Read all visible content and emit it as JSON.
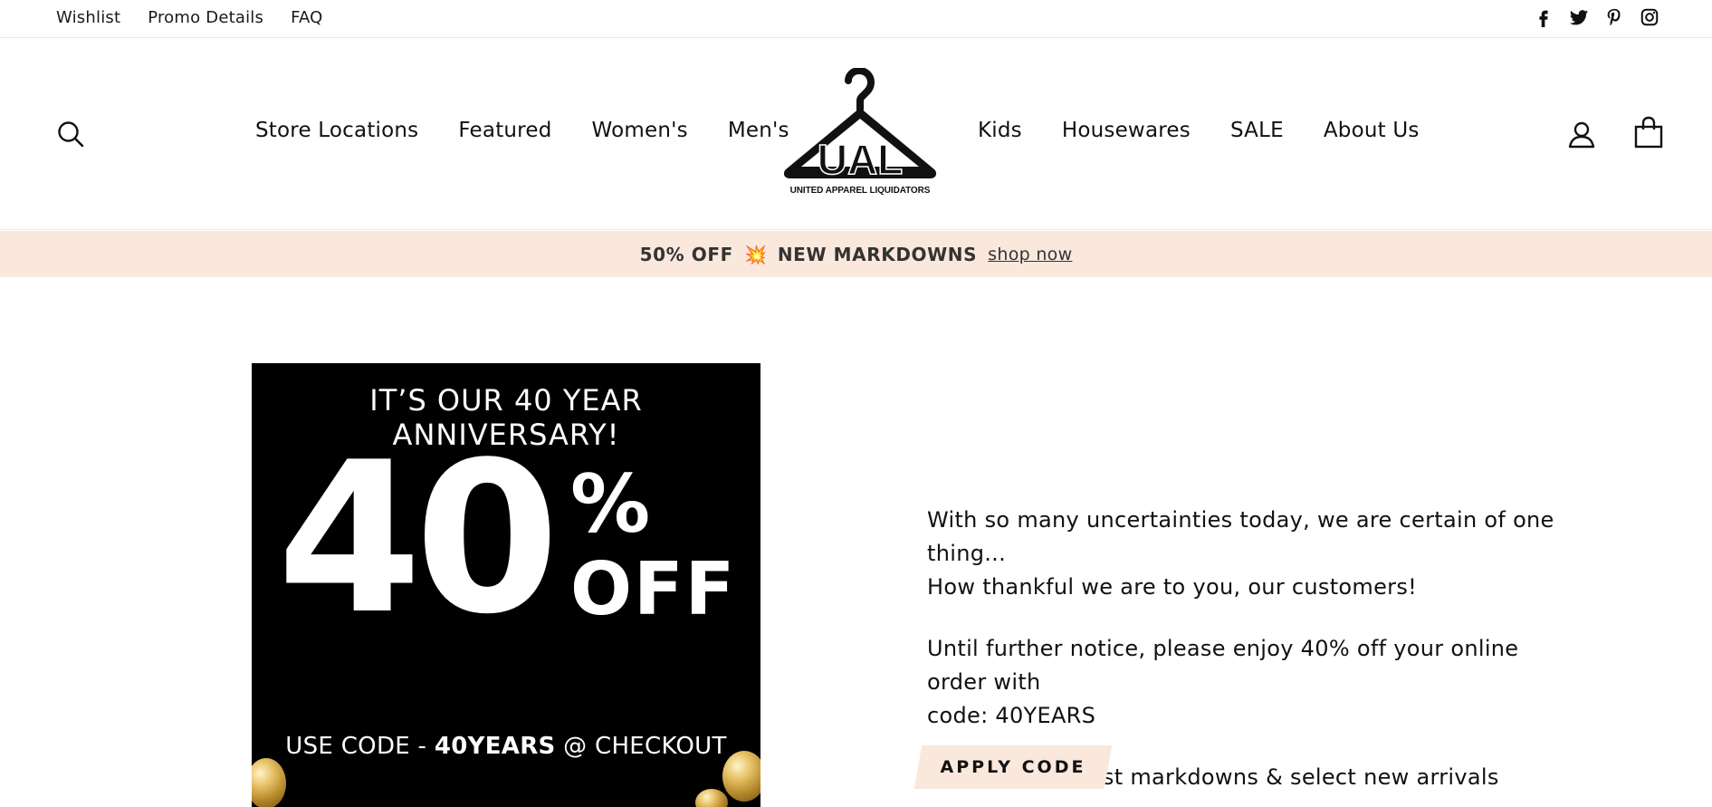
{
  "utility": {
    "links": [
      "Wishlist",
      "Promo Details",
      "FAQ"
    ],
    "social": [
      "facebook-icon",
      "twitter-icon",
      "pinterest-icon",
      "instagram-icon"
    ]
  },
  "header": {
    "nav_left": [
      "Store Locations",
      "Featured",
      "Women's",
      "Men's"
    ],
    "nav_right": [
      "Kids",
      "Housewares",
      "SALE",
      "About Us"
    ],
    "logo": {
      "letters": "UAL",
      "caption": "UNITED APPAREL LIQUIDATORS"
    },
    "icons": [
      "search-icon",
      "account-icon",
      "cart-icon"
    ]
  },
  "announcement": {
    "text_before": "50% OFF",
    "emoji": "💥",
    "text_after": "NEW MARKDOWNS",
    "link": "shop now"
  },
  "promo_image": {
    "headline": "IT’S OUR 40 YEAR ANNIVERSARY!",
    "number": "40",
    "percent": "%",
    "off": "OFF",
    "code_prefix": "USE CODE - ",
    "code": "40YEARS",
    "code_suffix": " @ CHECKOUT"
  },
  "copy": {
    "paragraph_1a": "With so many uncertainties today, we are certain of one thing...",
    "paragraph_1b": "How thankful we are to you, our customers!",
    "paragraph_2a": "Until further notice, please enjoy 40% off your online order with",
    "paragraph_2b": "code: 40YEARS",
    "paragraph_3": "*excludes newest markdowns & select new arrivals",
    "button": "APPLY CODE"
  },
  "colors": {
    "announcement_bg": "#fae8dd",
    "button_bg": "#fae8dd",
    "text": "#111111",
    "promo_bg": "#000000"
  }
}
